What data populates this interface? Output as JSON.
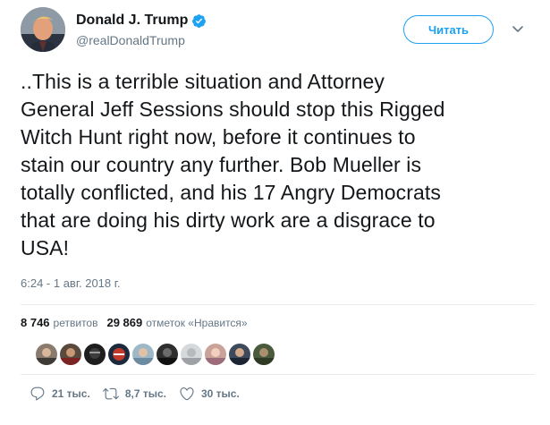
{
  "user": {
    "display_name": "Donald J. Trump",
    "handle": "@realDonaldTrump",
    "verified": true,
    "avatar_icon": "profile-photo-icon"
  },
  "follow_button": {
    "label": "Читать"
  },
  "tweet": {
    "lines": [
      "..This is a terrible situation and Attorney",
      "General Jeff Sessions should stop this Rigged",
      "Witch Hunt right now, before it continues to",
      "stain our country any further. Bob Mueller is",
      "totally conflicted, and his 17 Angry Democrats",
      "that are doing his dirty work are a disgrace to",
      "USA!"
    ],
    "timestamp": "6:24 - 1 авг. 2018 г."
  },
  "stats": {
    "retweets_count": "8 746",
    "retweets_label": "ретвитов",
    "likes_count": "29 869",
    "likes_label": "отметок «Нравится»"
  },
  "likers": {
    "count_shown": 10
  },
  "actions": {
    "reply_count": "21 тыс.",
    "retweet_count": "8,7 тыс.",
    "like_count": "30 тыс."
  },
  "colors": {
    "accent": "#1da1f2",
    "text": "#14171a",
    "secondary": "#657786",
    "divider": "#e6ecf0"
  }
}
